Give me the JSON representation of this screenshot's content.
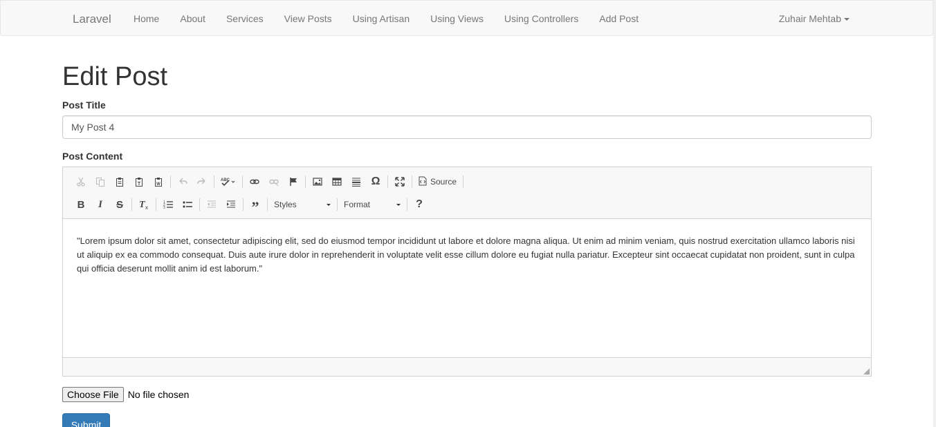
{
  "navbar": {
    "brand": "Laravel",
    "links": [
      "Home",
      "About",
      "Services",
      "View Posts",
      "Using Artisan",
      "Using Views",
      "Using Controllers",
      "Add Post"
    ],
    "user_name": "Zuhair Mehtab"
  },
  "page": {
    "title": "Edit Post"
  },
  "form": {
    "title_label": "Post Title",
    "title_value": "My Post 4",
    "content_label": "Post Content",
    "content_text": "\"Lorem ipsum dolor sit amet, consectetur adipiscing elit, sed do eiusmod tempor incididunt ut labore et dolore magna aliqua. Ut enim ad minim veniam, quis nostrud exercitation ullamco laboris nisi ut aliquip ex ea commodo consequat. Duis aute irure dolor in reprehenderit in voluptate velit esse cillum dolore eu fugiat nulla pariatur. Excepteur sint occaecat cupidatat non proident, sunt in culpa qui officia deserunt mollit anim id est laborum.\"",
    "choose_file_label": "Choose File",
    "file_status": "No file chosen",
    "submit_label": "Submit"
  },
  "editor_toolbar": {
    "source_label": "Source",
    "styles_label": "Styles",
    "format_label": "Format",
    "help_label": "?",
    "row1_icons": [
      "cut-icon",
      "copy-icon",
      "paste-icon",
      "paste-text-icon",
      "paste-word-icon",
      "undo-icon",
      "redo-icon",
      "spellcheck-icon",
      "link-icon",
      "unlink-icon",
      "anchor-icon",
      "image-icon",
      "table-icon",
      "horizontal-rule-icon",
      "special-char-icon",
      "maximize-icon",
      "source-icon"
    ],
    "row2_icons": [
      "bold-icon",
      "italic-icon",
      "strikethrough-icon",
      "remove-format-icon",
      "numbered-list-icon",
      "bulleted-list-icon",
      "decrease-indent-icon",
      "increase-indent-icon",
      "blockquote-icon",
      "styles-dropdown-arrow-icon",
      "format-dropdown-arrow-icon",
      "help-icon"
    ]
  },
  "colors": {
    "navbar_bg": "#f8f8f8",
    "nav_text": "#777777",
    "primary": "#337ab7",
    "editor_border": "#d1d1d1"
  }
}
